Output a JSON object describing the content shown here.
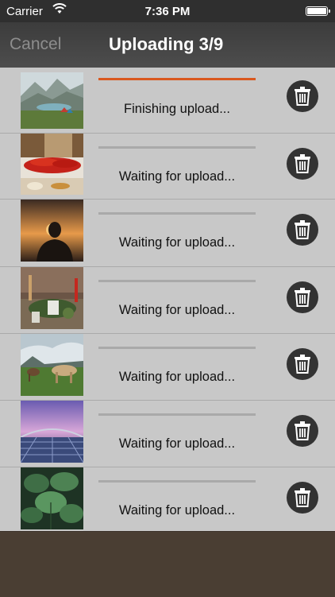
{
  "status_bar": {
    "carrier": "Carrier",
    "time": "7:36 PM"
  },
  "nav": {
    "cancel_label": "Cancel",
    "title": "Uploading 3/9"
  },
  "uploads": [
    {
      "status": "Finishing upload...",
      "progress": 1.0,
      "thumb": "mountain-lake-tents"
    },
    {
      "status": "Waiting for upload...",
      "progress": 0,
      "thumb": "red-chili-peppers"
    },
    {
      "status": "Waiting for upload...",
      "progress": 0,
      "thumb": "silhouette-sunset"
    },
    {
      "status": "Waiting for upload...",
      "progress": 0,
      "thumb": "candles-herbs-table"
    },
    {
      "status": "Waiting for upload...",
      "progress": 0,
      "thumb": "horses-grazing"
    },
    {
      "status": "Waiting for upload...",
      "progress": 0,
      "thumb": "purple-sky-bridge"
    },
    {
      "status": "Waiting for upload...",
      "progress": 0,
      "thumb": "green-plant-leaves"
    }
  ],
  "colors": {
    "accent": "#d9581f",
    "list_bg": "#c8c8c8",
    "navbar": "#434343",
    "footer": "#4a3e33"
  }
}
